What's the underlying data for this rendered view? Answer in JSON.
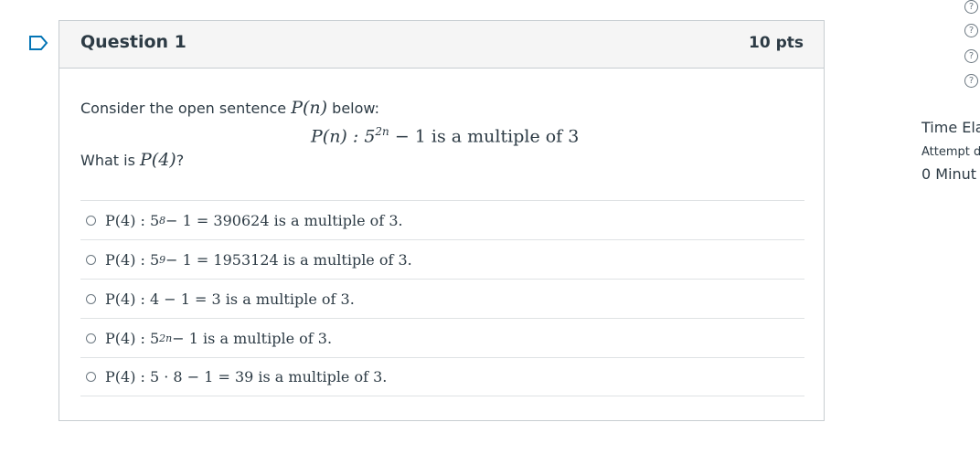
{
  "question": {
    "title": "Question 1",
    "points": "10 pts",
    "intro_text": "Consider the open sentence",
    "intro_math": "P(n)",
    "intro_suffix": "below:",
    "display_left": "P(n) : 5",
    "display_exp": "2n",
    "display_right": " − 1  is a multiple of 3",
    "what_text": "What is",
    "what_math": "P(4)",
    "what_suffix": "?"
  },
  "answers": [
    {
      "pre": "P(4) : 5",
      "sup": "8",
      "post": " − 1 = 390624  is a multiple of 3."
    },
    {
      "pre": "P(4) : 5",
      "sup": "9",
      "post": " − 1 = 1953124  is a multiple of 3."
    },
    {
      "pre": "P(4) : 4 − 1 = 3  is a multiple of 3.",
      "sup": "",
      "post": ""
    },
    {
      "pre": "P(4) : 5",
      "sup": "2n",
      "post": " − 1  is a multiple of 3."
    },
    {
      "pre": "P(4) : 5 · 8 − 1 = 39  is a multiple of 3.",
      "sup": "",
      "post": ""
    }
  ],
  "rail": {
    "help_icons": [
      "?",
      "?",
      "?",
      "?"
    ],
    "time_label": "Time Ela",
    "attempt_label": "Attempt d",
    "minutes_value": "0 Minut"
  },
  "colors": {
    "accent": "#0374b5",
    "text": "#2d3b45",
    "border": "#c7cdd1"
  }
}
